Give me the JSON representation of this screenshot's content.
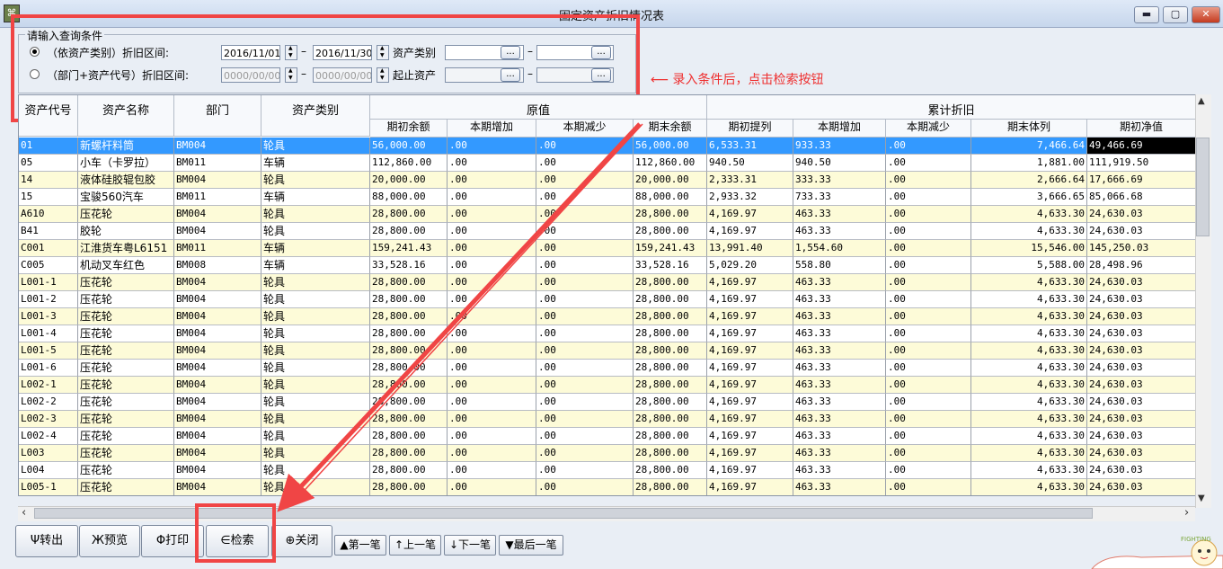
{
  "window": {
    "title": "固定资产折旧情况表",
    "minimize_icon": "minimize-icon",
    "maximize_icon": "maximize-icon",
    "close_icon": "close-icon"
  },
  "query": {
    "legend": "请输入查询条件",
    "row1": {
      "label": "（依资产类别）折旧区间:",
      "date_from": "2016/11/01",
      "dash1": "–",
      "date_to": "2016/11/30",
      "category_label": "资产类别",
      "dash2": "–",
      "browse": "..."
    },
    "row2": {
      "label": "（部门+资产代号）折旧区间:",
      "date_from_placeholder": "0000/00/00",
      "dash1": "–",
      "date_to_placeholder": "0000/00/00",
      "asset_label": "起止资产",
      "dash2": "–",
      "browse": "..."
    }
  },
  "annotation": {
    "callout": "录入条件后，点击检索按钮",
    "color": "#ee3030"
  },
  "grid": {
    "group_headers": {
      "original": "原值",
      "accumulated": "累计折旧"
    },
    "columns": [
      "资产代号",
      "资产名称",
      "部门",
      "资产类别",
      "期初余额",
      "本期增加",
      "本期减少",
      "期末余额",
      "期初提列",
      "本期增加",
      "本期减少",
      "期末体列",
      "期初净值"
    ],
    "rows": [
      [
        "01",
        "新螺杆料筒",
        "BM004",
        "轮具",
        "56,000.00",
        ".00",
        ".00",
        "56,000.00",
        "6,533.31",
        "933.33",
        ".00",
        "7,466.64",
        "49,466.69"
      ],
      [
        "05",
        "小车（卡罗拉）",
        "BM011",
        "车辆",
        "112,860.00",
        ".00",
        ".00",
        "112,860.00",
        "940.50",
        "940.50",
        ".00",
        "1,881.00",
        "111,919.50"
      ],
      [
        "14",
        "液体硅胶辊包胶",
        "BM004",
        "轮具",
        "20,000.00",
        ".00",
        ".00",
        "20,000.00",
        "2,333.31",
        "333.33",
        ".00",
        "2,666.64",
        "17,666.69"
      ],
      [
        "15",
        "宝骏560汽车",
        "BM011",
        "车辆",
        "88,000.00",
        ".00",
        ".00",
        "88,000.00",
        "2,933.32",
        "733.33",
        ".00",
        "3,666.65",
        "85,066.68"
      ],
      [
        "A610",
        "压花轮",
        "BM004",
        "轮具",
        "28,800.00",
        ".00",
        ".00",
        "28,800.00",
        "4,169.97",
        "463.33",
        ".00",
        "4,633.30",
        "24,630.03"
      ],
      [
        "B41",
        "胶轮",
        "BM004",
        "轮具",
        "28,800.00",
        ".00",
        ".00",
        "28,800.00",
        "4,169.97",
        "463.33",
        ".00",
        "4,633.30",
        "24,630.03"
      ],
      [
        "C001",
        "江淮货车粤L6151",
        "BM011",
        "车辆",
        "159,241.43",
        ".00",
        ".00",
        "159,241.43",
        "13,991.40",
        "1,554.60",
        ".00",
        "15,546.00",
        "145,250.03"
      ],
      [
        "C005",
        "机动叉车红色",
        "BM008",
        "车辆",
        "33,528.16",
        ".00",
        ".00",
        "33,528.16",
        "5,029.20",
        "558.80",
        ".00",
        "5,588.00",
        "28,498.96"
      ],
      [
        "L001-1",
        "压花轮",
        "BM004",
        "轮具",
        "28,800.00",
        ".00",
        ".00",
        "28,800.00",
        "4,169.97",
        "463.33",
        ".00",
        "4,633.30",
        "24,630.03"
      ],
      [
        "L001-2",
        "压花轮",
        "BM004",
        "轮具",
        "28,800.00",
        ".00",
        ".00",
        "28,800.00",
        "4,169.97",
        "463.33",
        ".00",
        "4,633.30",
        "24,630.03"
      ],
      [
        "L001-3",
        "压花轮",
        "BM004",
        "轮具",
        "28,800.00",
        ".00",
        ".00",
        "28,800.00",
        "4,169.97",
        "463.33",
        ".00",
        "4,633.30",
        "24,630.03"
      ],
      [
        "L001-4",
        "压花轮",
        "BM004",
        "轮具",
        "28,800.00",
        ".00",
        ".00",
        "28,800.00",
        "4,169.97",
        "463.33",
        ".00",
        "4,633.30",
        "24,630.03"
      ],
      [
        "L001-5",
        "压花轮",
        "BM004",
        "轮具",
        "28,800.00",
        ".00",
        ".00",
        "28,800.00",
        "4,169.97",
        "463.33",
        ".00",
        "4,633.30",
        "24,630.03"
      ],
      [
        "L001-6",
        "压花轮",
        "BM004",
        "轮具",
        "28,800.00",
        ".00",
        ".00",
        "28,800.00",
        "4,169.97",
        "463.33",
        ".00",
        "4,633.30",
        "24,630.03"
      ],
      [
        "L002-1",
        "压花轮",
        "BM004",
        "轮具",
        "28,800.00",
        ".00",
        ".00",
        "28,800.00",
        "4,169.97",
        "463.33",
        ".00",
        "4,633.30",
        "24,630.03"
      ],
      [
        "L002-2",
        "压花轮",
        "BM004",
        "轮具",
        "28,800.00",
        ".00",
        ".00",
        "28,800.00",
        "4,169.97",
        "463.33",
        ".00",
        "4,633.30",
        "24,630.03"
      ],
      [
        "L002-3",
        "压花轮",
        "BM004",
        "轮具",
        "28,800.00",
        ".00",
        ".00",
        "28,800.00",
        "4,169.97",
        "463.33",
        ".00",
        "4,633.30",
        "24,630.03"
      ],
      [
        "L002-4",
        "压花轮",
        "BM004",
        "轮具",
        "28,800.00",
        ".00",
        ".00",
        "28,800.00",
        "4,169.97",
        "463.33",
        ".00",
        "4,633.30",
        "24,630.03"
      ],
      [
        "L003",
        "压花轮",
        "BM004",
        "轮具",
        "28,800.00",
        ".00",
        ".00",
        "28,800.00",
        "4,169.97",
        "463.33",
        ".00",
        "4,633.30",
        "24,630.03"
      ],
      [
        "L004",
        "压花轮",
        "BM004",
        "轮具",
        "28,800.00",
        ".00",
        ".00",
        "28,800.00",
        "4,169.97",
        "463.33",
        ".00",
        "4,633.30",
        "24,630.03"
      ],
      [
        "L005-1",
        "压花轮",
        "BM004",
        "轮具",
        "28,800.00",
        ".00",
        ".00",
        "28,800.00",
        "4,169.97",
        "463.33",
        ".00",
        "4,633.30",
        "24,630.03"
      ]
    ],
    "selected_row_color": "#3399ff",
    "odd_row_color": "#fdfbd8"
  },
  "scrollbars": {
    "left_arrow": "‹",
    "right_arrow": "›",
    "up_arrow": "▲",
    "down_arrow": "▼"
  },
  "buttons": {
    "export": "Ψ转出",
    "preview": "Ж预览",
    "print": "Φ打印",
    "search": "∈检索",
    "close": "⊕关闭",
    "first": "▲第一笔",
    "prev": "↑上一笔",
    "next": "↓下一笔",
    "last": "▼最后一笔"
  },
  "mascot": {
    "text": "FIGHTING"
  }
}
